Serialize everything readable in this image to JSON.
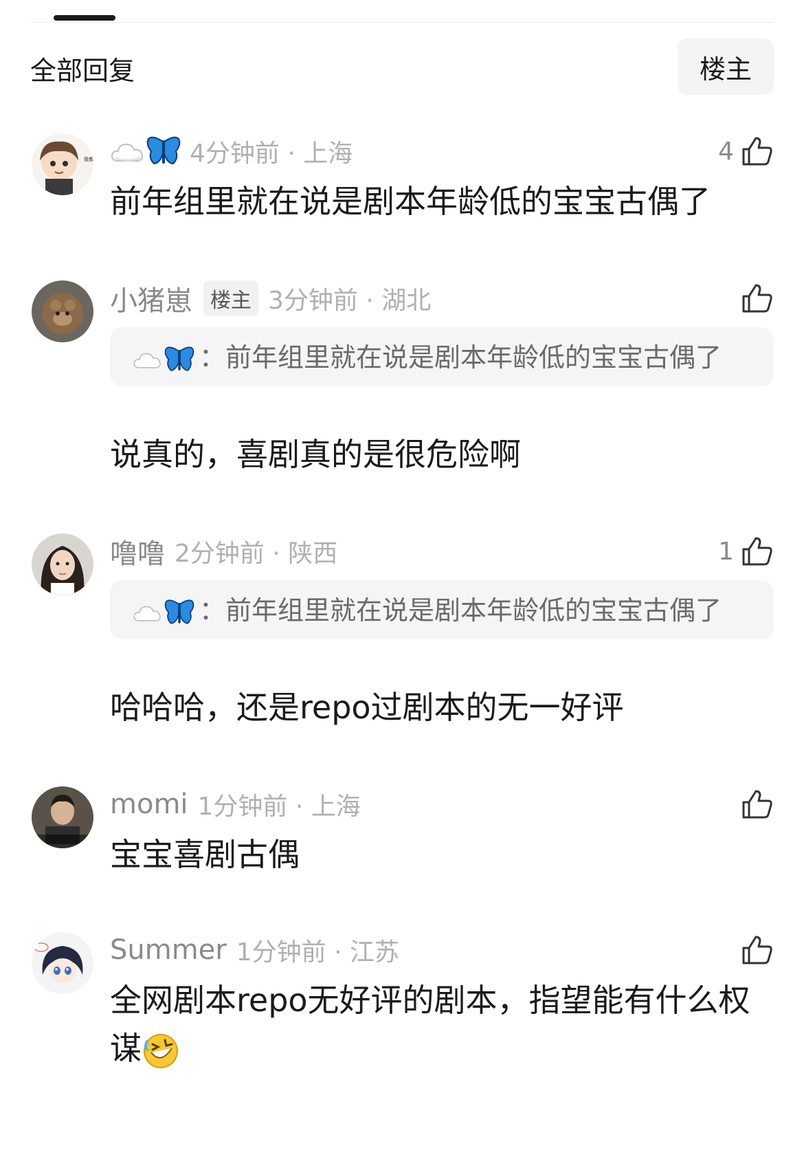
{
  "header": {
    "section_title": "全部回复",
    "filter_button": "楼主"
  },
  "comments": [
    {
      "username": "",
      "username_emoji": [
        "cloud-icon",
        "butterfly-icon"
      ],
      "time_location": "4分钟前 · 上海",
      "likes": "4",
      "content": "前年组里就在说是剧本年龄低的宝宝古偶了"
    },
    {
      "username": "小猪崽",
      "badge": "楼主",
      "time_location": "3分钟前 · 湖北",
      "likes": "",
      "quote_author_emoji": [
        "cloud-icon",
        "butterfly-icon"
      ],
      "quote_separator": "：",
      "quote_text": "前年组里就在说是剧本年龄低的宝宝古偶了",
      "content": "说真的，喜剧真的是很危险啊"
    },
    {
      "username": "噜噜",
      "time_location": "2分钟前 · 陕西",
      "likes": "1",
      "quote_author_emoji": [
        "cloud-icon",
        "butterfly-icon"
      ],
      "quote_separator": "：",
      "quote_text": "前年组里就在说是剧本年龄低的宝宝古偶了",
      "content": "哈哈哈，还是repo过剧本的无一好评"
    },
    {
      "username": "momi",
      "time_location": "1分钟前 · 上海",
      "likes": "",
      "content": "宝宝喜剧古偶"
    },
    {
      "username": "Summer",
      "time_location": "1分钟前 · 江苏",
      "likes": "",
      "content": "全网剧本repo无好评的剧本，指望能有什么权谋",
      "content_emoji": "rofl-emoji"
    }
  ],
  "colors": {
    "username": "#8a8a8a",
    "time": "#b0b0b0",
    "quote_bg": "#f5f5f5",
    "butterfly": "#2a8be0"
  }
}
